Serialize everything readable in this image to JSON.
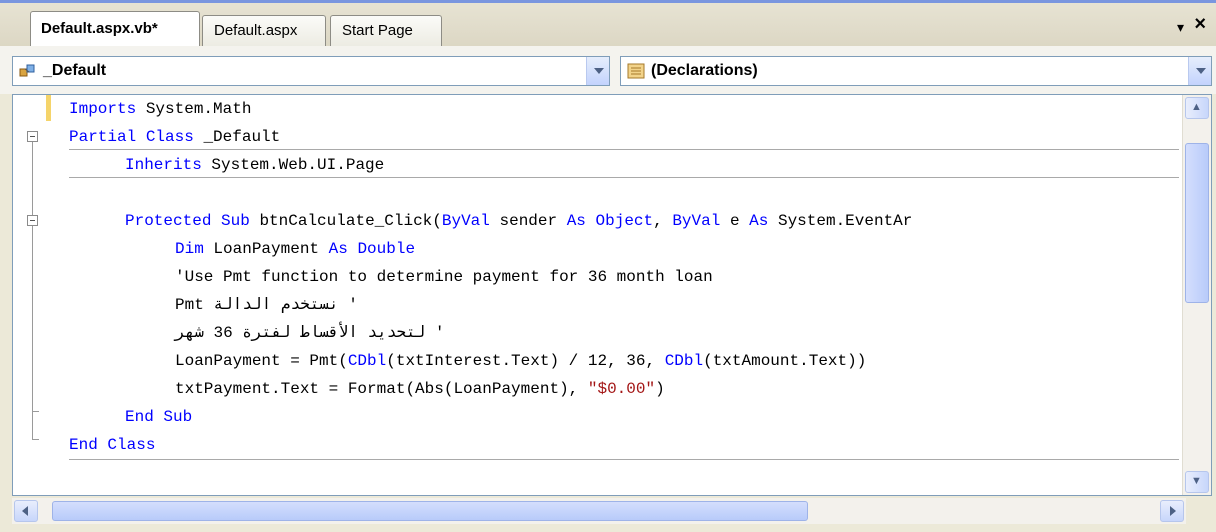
{
  "tabs": [
    {
      "label": "Default.aspx.vb*",
      "active": true
    },
    {
      "label": "Default.aspx",
      "active": false
    },
    {
      "label": "Start Page",
      "active": false
    }
  ],
  "tab_controls": {
    "menu_glyph": "▾",
    "close_glyph": "×"
  },
  "navbar": {
    "class_combo": {
      "value": "_Default",
      "icon": "class-icon"
    },
    "member_combo": {
      "value": "(Declarations)",
      "icon": "declarations-icon"
    }
  },
  "code": {
    "l1": {
      "kw": "Imports",
      "text": " System.Math"
    },
    "l2": {
      "kw1": "Partial",
      "kw2": "Class",
      "text": " _Default"
    },
    "l3": {
      "kw": "Inherits",
      "text": " System.Web.UI.Page"
    },
    "l5": {
      "kw1": "Protected",
      "kw2": "Sub",
      "t1": " btnCalculate_Click(",
      "kw3": "ByVal",
      "t2": " sender ",
      "kw4": "As",
      "kw5": "Object",
      "t3": ", ",
      "kw6": "ByVal",
      "t4": " e ",
      "kw7": "As",
      "t5": " System.EventAr"
    },
    "l6": {
      "kw1": "Dim",
      "text": " LoanPayment ",
      "kw2": "As",
      "kw3": "Double"
    },
    "l7": {
      "text": "'Use Pmt function to determine payment for 36 month loan"
    },
    "l8": {
      "text": "' نستخدم الدالة Pmt"
    },
    "l9": {
      "text": "' لتحديد الأقساط لفترة 36 شهر"
    },
    "l10": {
      "t1": "LoanPayment = Pmt(",
      "kw1": "CDbl",
      "t2": "(txtInterest.Text) / 12, 36, ",
      "kw2": "CDbl",
      "t3": "(txtAmount.Text))"
    },
    "l11": {
      "t1": "txtPayment.Text = Format(Abs(LoanPayment), ",
      "str": "\"$0.00\"",
      "t2": ")"
    },
    "l12": {
      "kw1": "End",
      "kw2": "Sub"
    },
    "l13": {
      "kw1": "End",
      "kw2": "Class"
    }
  },
  "colors": {
    "keyword": "#0000ff",
    "string": "#a31515",
    "text": "#000000"
  }
}
